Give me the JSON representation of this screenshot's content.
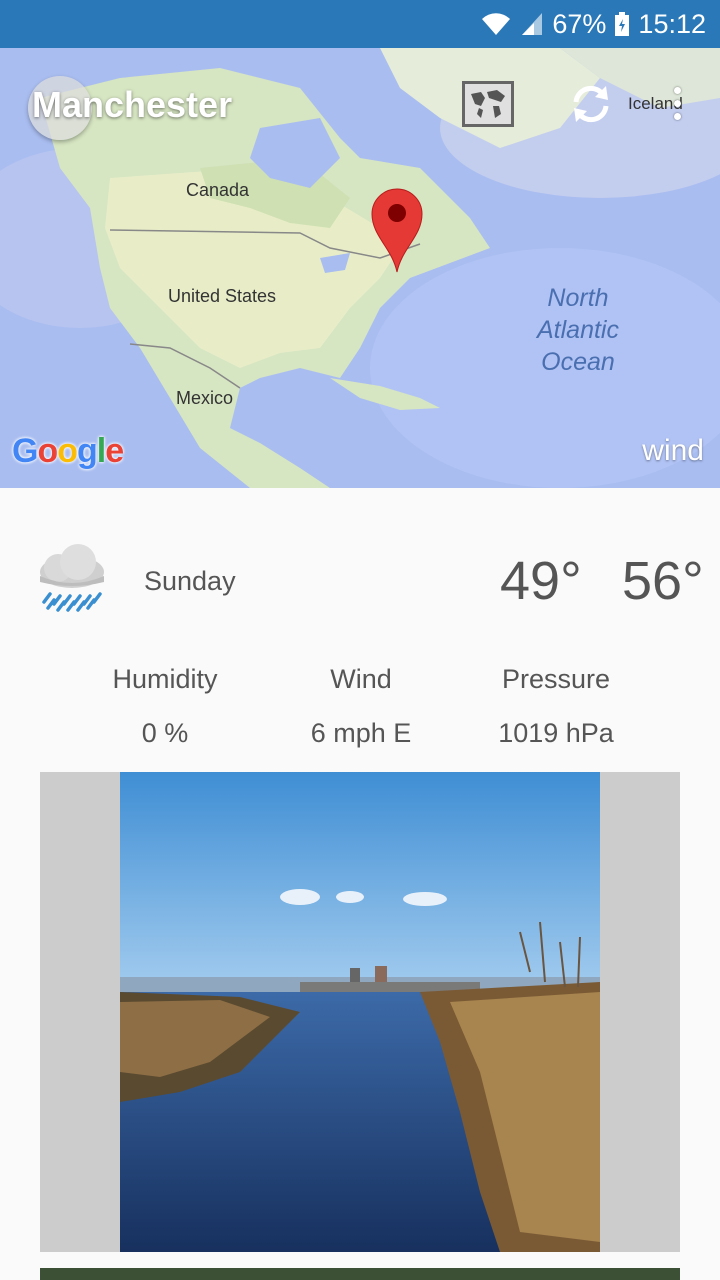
{
  "status_bar": {
    "battery_percent": "67%",
    "time": "15:12"
  },
  "header": {
    "city": "Manchester",
    "map_labels": {
      "canada": "Canada",
      "usa": "United States",
      "mexico": "Mexico",
      "iceland": "Iceland",
      "ocean": [
        "North",
        "Atlantic",
        "Ocean"
      ]
    },
    "map_attribution": "Google",
    "map_layer": "wind"
  },
  "forecast": {
    "day": "Sunday",
    "icon": "rain-cloud-icon",
    "temp_low": "49°",
    "temp_high": "56°",
    "stats": [
      {
        "label": "Humidity",
        "value": "0 %"
      },
      {
        "label": "Wind",
        "value": "6 mph E"
      },
      {
        "label": "Pressure",
        "value": "1019 hPa"
      }
    ]
  },
  "colors": {
    "status_bar": "#2a78b8",
    "pin": "#e53935",
    "text": "#555555",
    "card_bg": "#cccccc"
  }
}
